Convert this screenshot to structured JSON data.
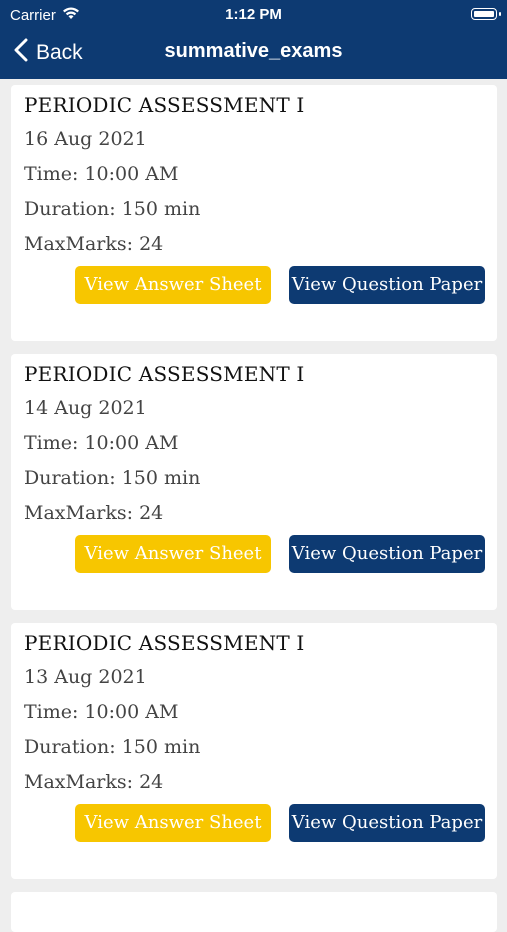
{
  "status_bar": {
    "carrier": "Carrier",
    "time": "1:12 PM"
  },
  "nav": {
    "back_label": "Back",
    "title": "summative_exams"
  },
  "exams": [
    {
      "title": "PERIODIC ASSESSMENT I",
      "date": "16 Aug 2021",
      "time": "Time: 10:00 AM",
      "duration": "Duration: 150 min",
      "max_marks": "MaxMarks: 24",
      "answer_btn": "View Answer Sheet",
      "question_btn": "View Question Paper"
    },
    {
      "title": "PERIODIC ASSESSMENT I",
      "date": "14 Aug 2021",
      "time": "Time: 10:00 AM",
      "duration": "Duration: 150 min",
      "max_marks": "MaxMarks: 24",
      "answer_btn": "View Answer Sheet",
      "question_btn": "View Question Paper"
    },
    {
      "title": "PERIODIC ASSESSMENT I",
      "date": "13 Aug 2021",
      "time": "Time: 10:00 AM",
      "duration": "Duration: 150 min",
      "max_marks": "MaxMarks: 24",
      "answer_btn": "View Answer Sheet",
      "question_btn": "View Question Paper"
    }
  ],
  "colors": {
    "nav_bg": "#0d3a72",
    "answer_btn": "#f7c600",
    "question_btn": "#0d3a72",
    "page_bg": "#eeeeee"
  }
}
